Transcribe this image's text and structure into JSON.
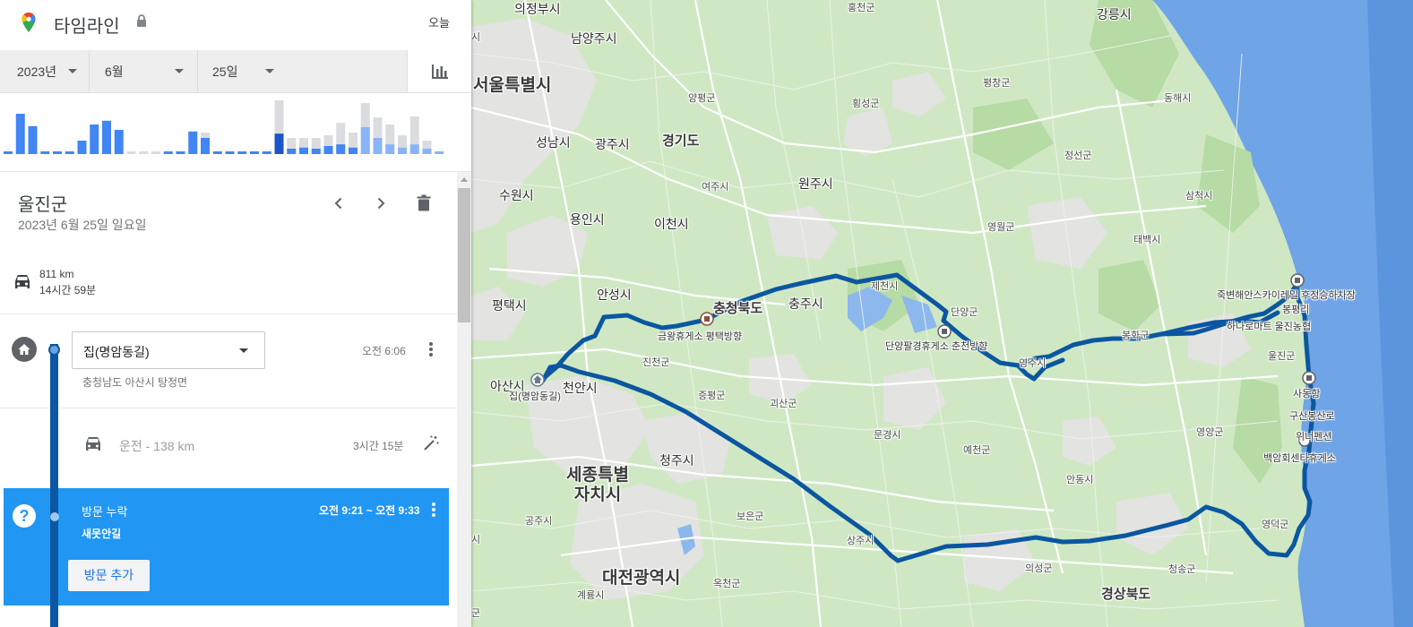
{
  "header": {
    "app_title": "타임라인",
    "today_label": "오늘",
    "icons": [
      "maps-pin-icon",
      "lock-icon"
    ]
  },
  "date_selector": {
    "year": "2023년",
    "month": "6월",
    "day": "25일",
    "stats_icon": "bar-chart-icon"
  },
  "histogram": {
    "colors": {
      "selected": "#1a56c9",
      "active": "#4285f4",
      "light": "#8ab4f8",
      "empty": "#dadce0"
    },
    "bars": [
      {
        "v": 0.04,
        "c": "active"
      },
      {
        "v": 0.75,
        "c": "active"
      },
      {
        "v": 0.52,
        "c": "active"
      },
      {
        "v": 0.05,
        "c": "active"
      },
      {
        "v": 0.05,
        "c": "active"
      },
      {
        "v": 0.05,
        "c": "active"
      },
      {
        "v": 0.25,
        "c": "active"
      },
      {
        "v": 0.55,
        "c": "active"
      },
      {
        "v": 0.62,
        "c": "active"
      },
      {
        "v": 0.45,
        "c": "active"
      },
      {
        "v": 0.05,
        "c": "empty"
      },
      {
        "v": 0.05,
        "c": "empty"
      },
      {
        "v": 0.05,
        "c": "empty"
      },
      {
        "v": 0.05,
        "c": "active"
      },
      {
        "v": 0.05,
        "c": "active"
      },
      {
        "v": 0.42,
        "c": "active",
        "bg": 0.42
      },
      {
        "v": 0.3,
        "c": "active",
        "bg": 0.4
      },
      {
        "v": 0.05,
        "c": "active"
      },
      {
        "v": 0.05,
        "c": "active"
      },
      {
        "v": 0.05,
        "c": "active"
      },
      {
        "v": 0.05,
        "c": "active"
      },
      {
        "v": 0.05,
        "c": "active"
      },
      {
        "v": 0.38,
        "c": "selected",
        "bg": 1.0
      },
      {
        "v": 0.1,
        "c": "active",
        "bg": 0.3
      },
      {
        "v": 0.12,
        "c": "active",
        "bg": 0.3
      },
      {
        "v": 0.1,
        "c": "active",
        "bg": 0.3
      },
      {
        "v": 0.15,
        "c": "active",
        "bg": 0.35
      },
      {
        "v": 0.18,
        "c": "active",
        "bg": 0.58
      },
      {
        "v": 0.12,
        "c": "active",
        "bg": 0.4
      },
      {
        "v": 0.5,
        "c": "light",
        "bg": 0.95
      },
      {
        "v": 0.3,
        "c": "light",
        "bg": 0.68
      },
      {
        "v": 0.18,
        "c": "light",
        "bg": 0.55
      },
      {
        "v": 0.12,
        "c": "light",
        "bg": 0.35
      },
      {
        "v": 0.18,
        "c": "light",
        "bg": 0.7
      },
      {
        "v": 0.1,
        "c": "light",
        "bg": 0.25
      },
      {
        "v": 0.05,
        "c": "light"
      }
    ]
  },
  "day": {
    "place_title": "울진군",
    "date_label": "2023년 6월 25일 일요일",
    "icons": [
      "chevron-left-icon",
      "chevron-right-icon",
      "trash-icon"
    ],
    "summary": {
      "distance": "811 km",
      "duration": "14시간 59분",
      "icon": "car-icon"
    }
  },
  "timeline": {
    "home": {
      "place_name": "집(명암동길)",
      "time": "오전 6:06",
      "address": "충청남도 아산시 탕정면",
      "icon": "home-icon"
    },
    "drive": {
      "label": "운전 - 138 km",
      "duration": "3시간 15분",
      "icons": [
        "car-icon",
        "magic-wand-icon"
      ]
    },
    "missing_visit": {
      "title": "방문 누락",
      "subtitle": "새못안길",
      "time": "오전 9:21 ~ 오전 9:33",
      "add_button": "방문 추가",
      "icon": "question-icon",
      "color": "#2196f3"
    }
  },
  "map": {
    "route_color": "#0b56a0",
    "labels_big": [
      "서울특별시",
      "경기도",
      "충청북도",
      "세종특별\n자치시",
      "대전광역시",
      "경상북도"
    ],
    "labels_city": [
      "의정부시",
      "남양주시",
      "강릉시",
      "성남시",
      "광주시",
      "수원시",
      "용인시",
      "이천시",
      "원주시",
      "평택시",
      "안성시",
      "충주시",
      "아산시",
      "천안시",
      "청주시"
    ],
    "labels_county": [
      "홍천군",
      "양평군",
      "횡성군",
      "평창군",
      "동해시",
      "정선군",
      "삼척시",
      "여주시",
      "영월군",
      "태백시",
      "제천시",
      "단양군",
      "봉화군",
      "영주시",
      "울진군",
      "진천군",
      "증평군",
      "괴산군",
      "문경시",
      "예천군",
      "안동시",
      "영양군",
      "공주시",
      "보은군",
      "상주시",
      "의성군",
      "청송군",
      "영덕군",
      "옥천군",
      "계룡시",
      "시",
      "시",
      "군"
    ],
    "labels_poi": [
      "금왕휴게소 평택방향",
      "단양팔경휴게소 춘천방향",
      "죽변해안스카이레일 후정승하차장",
      "봉평리",
      "하나로마트 울진농협",
      "사동항",
      "구산봉산로",
      "위너펜션",
      "백암회센타휴게소",
      "집(명암동길)"
    ]
  }
}
